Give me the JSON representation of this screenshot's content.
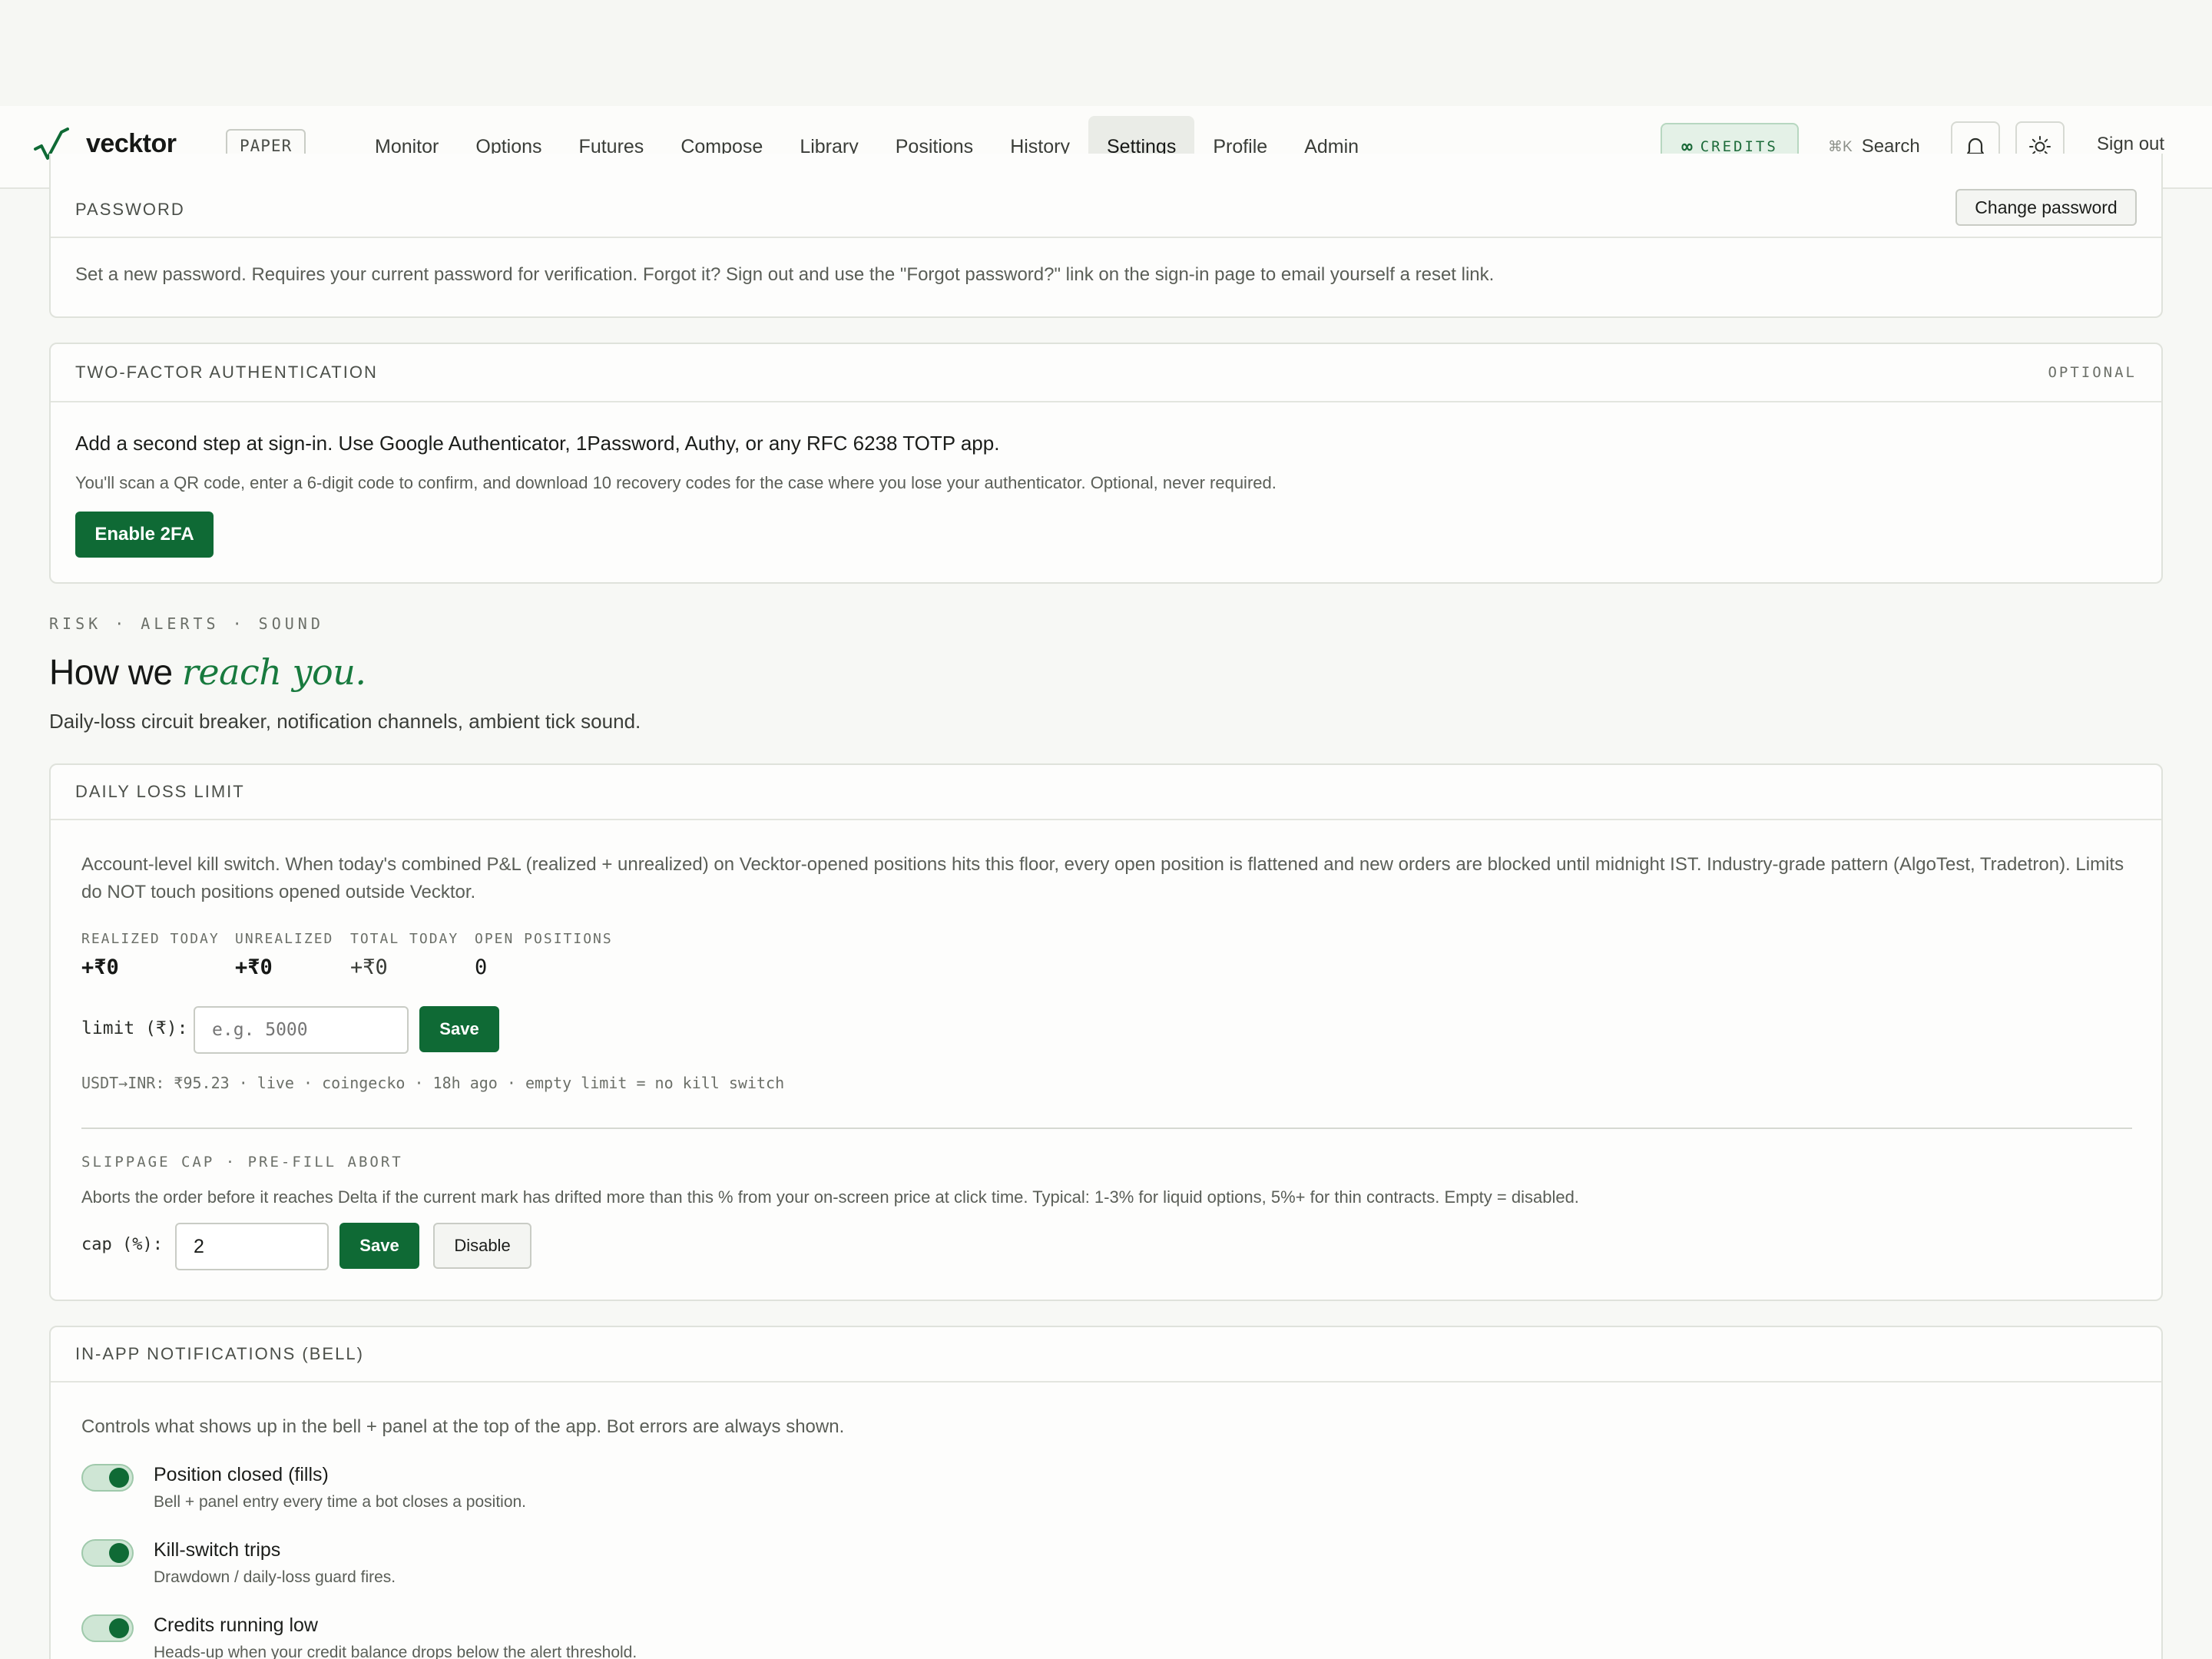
{
  "header": {
    "brand": "vecktor",
    "badge": "PAPER",
    "nav": [
      "Monitor",
      "Options",
      "Futures",
      "Compose",
      "Library",
      "Positions",
      "History",
      "Settings",
      "Profile",
      "Admin"
    ],
    "active_nav": "Settings",
    "credits_label": "CREDITS",
    "credits_symbol": "∞",
    "search_kbd": "⌘K",
    "search_label": "Search",
    "signout_label": "Sign out",
    "accent": "#0f6a35"
  },
  "password": {
    "title": "PASSWORD",
    "button": "Change password",
    "description": "Set a new password. Requires your current password for verification. Forgot it? Sign out and use the \"Forgot password?\" link on the sign-in page to email yourself a reset link."
  },
  "twofa": {
    "title": "TWO-FACTOR AUTHENTICATION",
    "tag": "OPTIONAL",
    "lead": "Add a second step at sign-in. Use Google Authenticator, 1Password, Authy, or any RFC 6238 TOTP app.",
    "detail": "You'll scan a QR code, enter a 6-digit code to confirm, and download 10 recovery codes for the case where you lose your authenticator. Optional, never required.",
    "button": "Enable 2FA"
  },
  "section": {
    "kicker": "RISK · ALERTS · SOUND",
    "title_plain": "How we ",
    "title_em": "reach you.",
    "description": "Daily-loss circuit breaker, notification channels, ambient tick sound."
  },
  "daily_loss": {
    "title": "DAILY LOSS LIMIT",
    "description": "Account-level kill switch. When today's combined P&L (realized + unrealized) on Vecktor-opened positions hits this floor, every open position is flattened and new orders are blocked until midnight IST. Industry-grade pattern (AlgoTest, Tradetron). Limits do NOT touch positions opened outside Vecktor.",
    "stats": [
      {
        "label": "REALIZED TODAY",
        "value": "+₹0"
      },
      {
        "label": "UNREALIZED",
        "value": "+₹0"
      },
      {
        "label": "TOTAL TODAY",
        "value": "+₹0"
      },
      {
        "label": "OPEN POSITIONS",
        "value": "0"
      }
    ],
    "limit_label": "limit (₹):",
    "limit_placeholder": "e.g. 5000",
    "save_label": "Save",
    "fx_note": "USDT→INR: ₹95.23 · live · coingecko · 18h ago · empty limit = no kill switch",
    "slippage_title": "SLIPPAGE CAP · PRE-FILL ABORT",
    "slippage_desc": "Aborts the order before it reaches Delta if the current mark has drifted more than this % from your on-screen price at click time. Typical: 1-3% for liquid options, 5%+ for thin contracts. Empty = disabled.",
    "cap_label": "cap (%):",
    "cap_value": "2",
    "cap_save": "Save",
    "cap_disable": "Disable"
  },
  "notifications": {
    "title": "IN-APP NOTIFICATIONS (BELL)",
    "description": "Controls what shows up in the bell + panel at the top of the app. Bot errors are always shown.",
    "items": [
      {
        "title": "Position closed (fills)",
        "desc": "Bell + panel entry every time a bot closes a position.",
        "on": true
      },
      {
        "title": "Kill-switch trips",
        "desc": "Drawdown / daily-loss guard fires.",
        "on": true
      },
      {
        "title": "Credits running low",
        "desc": "Heads-up when your credit balance drops below the alert threshold.",
        "on": true
      }
    ]
  }
}
